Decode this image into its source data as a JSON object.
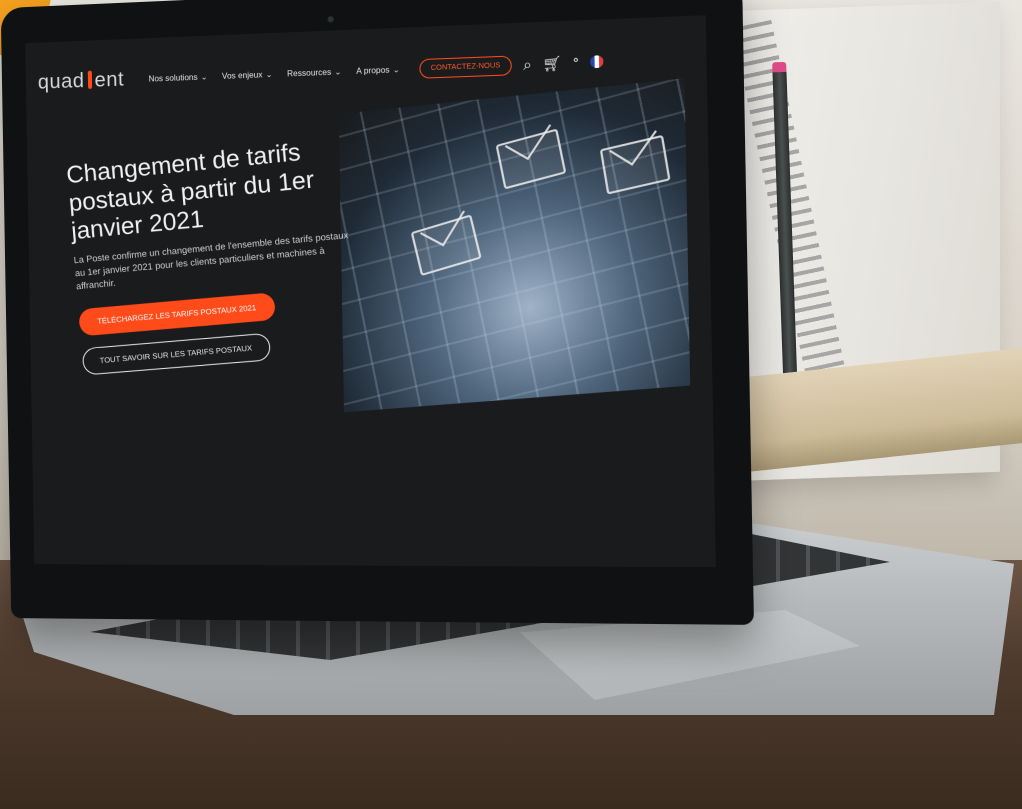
{
  "site": {
    "logo_text_left": "quad",
    "logo_text_right": "ent",
    "nav": [
      {
        "label": "Nos solutions"
      },
      {
        "label": "Vos enjeux"
      },
      {
        "label": "Ressources"
      },
      {
        "label": "A propos"
      }
    ],
    "contact_label": "CONTACTEZ-NOUS",
    "icons": [
      "search-icon",
      "cart-icon",
      "user-icon",
      "french-flag-icon"
    ]
  },
  "hero": {
    "title": "Changement de tarifs postaux à partir du 1er janvier 2021",
    "description": "La Poste confirme un changement de l'ensemble des tarifs postaux au 1er janvier 2021 pour les clients particuliers et machines à affranchir.",
    "primary_cta": "TÉLÉCHARGEZ LES TARIFS POSTAUX 2021",
    "secondary_cta": "TOUT SAVOIR SUR LES TARIFS POSTAUX"
  },
  "colors": {
    "accent": "#ff4a1a",
    "screen_bg": "#191b1c",
    "corner_shape": "#f6a11f"
  }
}
